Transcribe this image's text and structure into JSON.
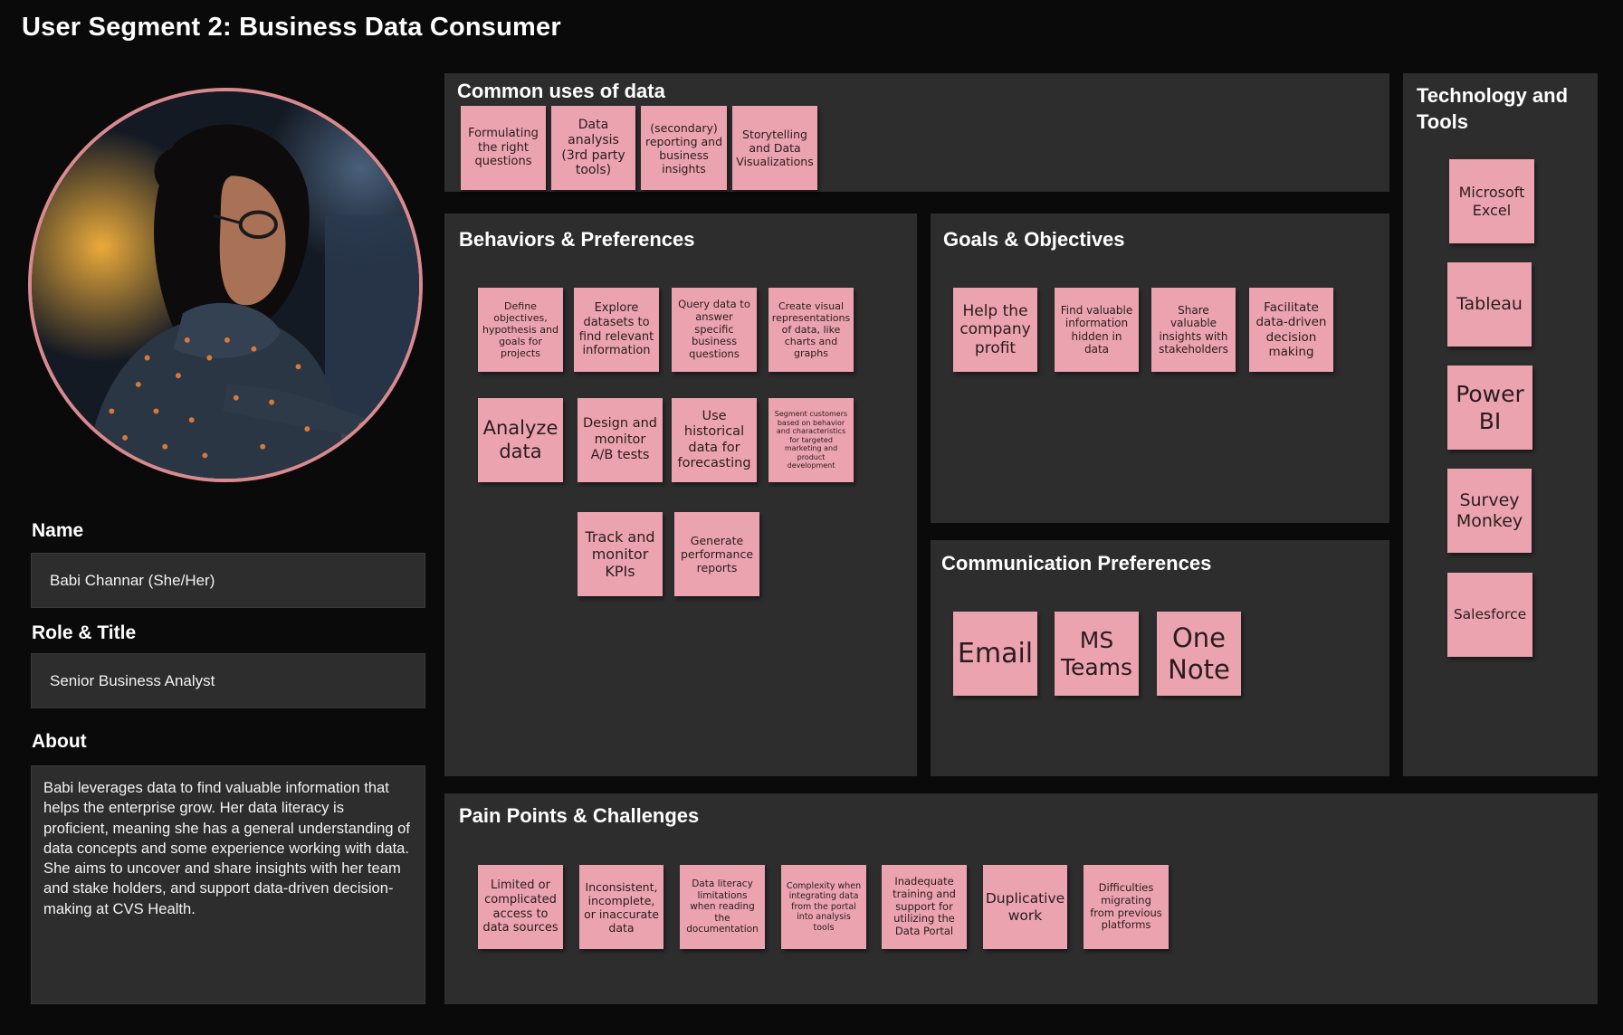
{
  "page": {
    "title": "User Segment 2: Business Data Consumer"
  },
  "persona": {
    "name_label": "Name",
    "name_value": "Babi Channar (She/Her)",
    "role_label": "Role & Title",
    "role_value": "Senior Business Analyst",
    "about_label": "About",
    "about_value": "Babi leverages data to find valuable information that helps the enterprise grow. Her data literacy is proficient, meaning she has a general understanding of data concepts and some experience working with data. She aims to uncover and share insights with her team and stake holders, and support data-driven decision-making at CVS Health."
  },
  "common_uses": {
    "title": "Common uses of data",
    "notes": [
      "Formulating the right questions",
      "Data analysis (3rd party tools)",
      "(secondary) reporting and business insights",
      "Storytelling and Data Visualizations"
    ]
  },
  "behaviors": {
    "title": "Behaviors & Preferences",
    "notes": [
      "Define objectives, hypothesis and goals for projects",
      "Explore datasets to find relevant information",
      "Query data to answer specific business questions",
      "Create visual representations of data, like charts and graphs",
      "Analyze data",
      "Design and monitor A/B tests",
      "Use historical data for forecasting",
      "Segment customers based on behavior and characteristics for targeted marketing and product development",
      "Track and monitor KPIs",
      "Generate performance reports"
    ]
  },
  "goals": {
    "title": "Goals & Objectives",
    "notes": [
      "Help the company profit",
      "Find valuable information hidden in data",
      "Share valuable insights with stakeholders",
      "Facilitate data-driven decision making"
    ]
  },
  "communication": {
    "title": "Communication Preferences",
    "notes": [
      "Email",
      "MS Teams",
      "One Note"
    ]
  },
  "tools": {
    "title": "Technology and Tools",
    "notes": [
      "Microsoft Excel",
      "Tableau",
      "Power BI",
      "Survey Monkey",
      "Salesforce"
    ]
  },
  "pain_points": {
    "title": "Pain Points & Challenges",
    "notes": [
      "Limited or complicated access to data sources",
      "Inconsistent, incomplete, or inaccurate data",
      "Data literacy limitations when reading the documentation",
      "Complexity when integrating data from the portal into analysis tools",
      "Inadequate training and support for utilizing the Data Portal",
      "Duplicative work",
      "Difficulties migrating from previous platforms"
    ]
  },
  "colors": {
    "background": "#0a0a0a",
    "panel": "#2d2d2d",
    "sticky_note": "#eba3b0",
    "portrait_border": "#d98a8f"
  }
}
